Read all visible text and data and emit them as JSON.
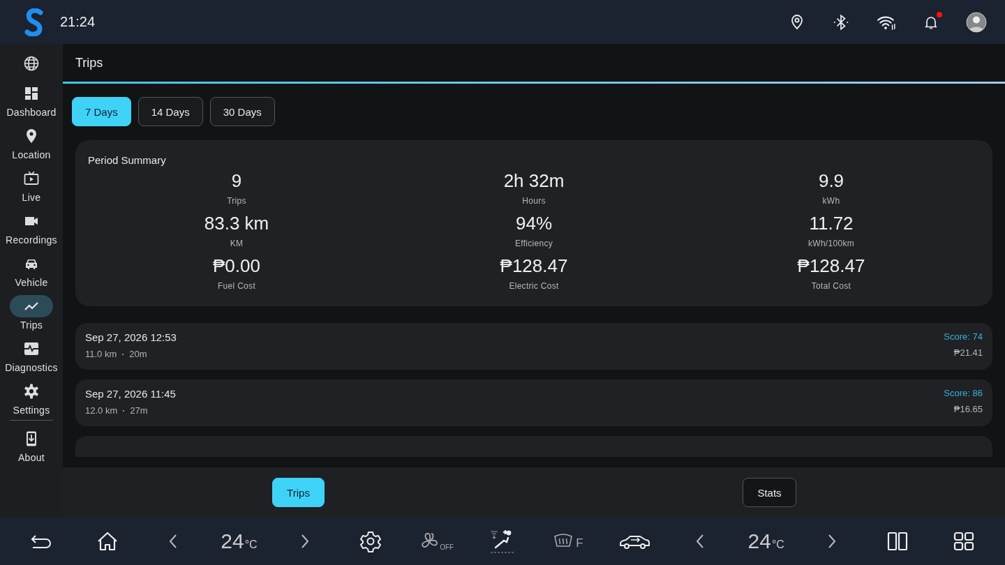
{
  "status_bar": {
    "time": "21:24",
    "notifications": {
      "unread": true
    }
  },
  "sidebar": {
    "items": [
      {
        "selected": false
      },
      {
        "label": "Dashboard",
        "selected": false
      },
      {
        "label": "Location",
        "selected": false
      },
      {
        "label": "Live",
        "selected": false
      },
      {
        "label": "Recordings",
        "selected": false
      },
      {
        "label": "Vehicle",
        "selected": false
      },
      {
        "label": "Trips",
        "selected": true
      },
      {
        "label": "Diagnostics",
        "selected": false
      },
      {
        "label": "Settings",
        "selected": false
      },
      {
        "label": "About",
        "selected": false
      }
    ]
  },
  "page": {
    "title": "Trips"
  },
  "range_tabs": [
    {
      "label": "7 Days",
      "selected": true
    },
    {
      "label": "14 Days",
      "selected": false
    },
    {
      "label": "30 Days",
      "selected": false
    }
  ],
  "summary": {
    "title": "Period Summary",
    "stats": [
      {
        "value": "9",
        "label": "Trips"
      },
      {
        "value": "2h 32m",
        "label": "Hours"
      },
      {
        "value": "9.9",
        "label": "kWh"
      },
      {
        "value": "83.3 km",
        "label": "KM"
      },
      {
        "value": "94%",
        "label": "Efficiency"
      },
      {
        "value": "11.72",
        "label": "kWh/100km"
      },
      {
        "value": "₱0.00",
        "label": "Fuel Cost"
      },
      {
        "value": "₱128.47",
        "label": "Electric Cost"
      },
      {
        "value": "₱128.47",
        "label": "Total Cost"
      }
    ]
  },
  "trips": [
    {
      "date": "Sep 27, 2026 12:53",
      "distance": "11.0 km",
      "duration": "20m",
      "score": "Score: 74",
      "cost": "₱21.41"
    },
    {
      "date": "Sep 27, 2026 11:45",
      "distance": "12.0 km",
      "duration": "27m",
      "score": "Score: 86",
      "cost": "₱16.65"
    }
  ],
  "view_tabs": [
    {
      "label": "Trips",
      "selected": true
    },
    {
      "label": "Stats",
      "selected": false
    }
  ],
  "climate": {
    "left_temp": {
      "value": "24",
      "unit": "°C"
    },
    "fan": "OFF",
    "defrost": "F",
    "right_temp": {
      "value": "24",
      "unit": "°C"
    }
  }
}
